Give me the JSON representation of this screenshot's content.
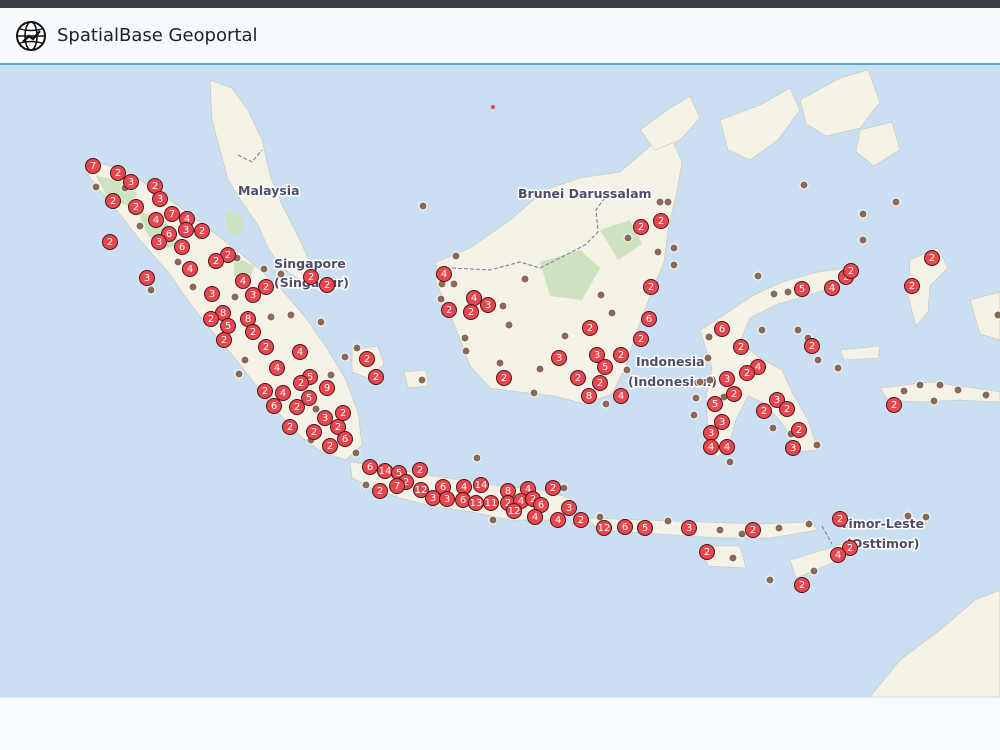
{
  "app": {
    "title": "SpatialBase Geoportal",
    "logo_icon": "globe-icon"
  },
  "map": {
    "labels": [
      {
        "id": "malaysia",
        "text": "Malaysia"
      },
      {
        "id": "singapore1",
        "text": "Singapore"
      },
      {
        "id": "singapore2",
        "text": "(Singapur)"
      },
      {
        "id": "brunei",
        "text": "Brunei Darussalam"
      },
      {
        "id": "indonesia1",
        "text": "Indonesia"
      },
      {
        "id": "indonesia2",
        "text": "(Indonesien)"
      },
      {
        "id": "timor1",
        "text": "Timor-Leste"
      },
      {
        "id": "timor2",
        "text": "(Osttimor)"
      }
    ],
    "cluster_color": "#e8474f",
    "point_color": "#8b6a55",
    "land_color": "#f4f1e6",
    "water_color": "#cadff2"
  }
}
